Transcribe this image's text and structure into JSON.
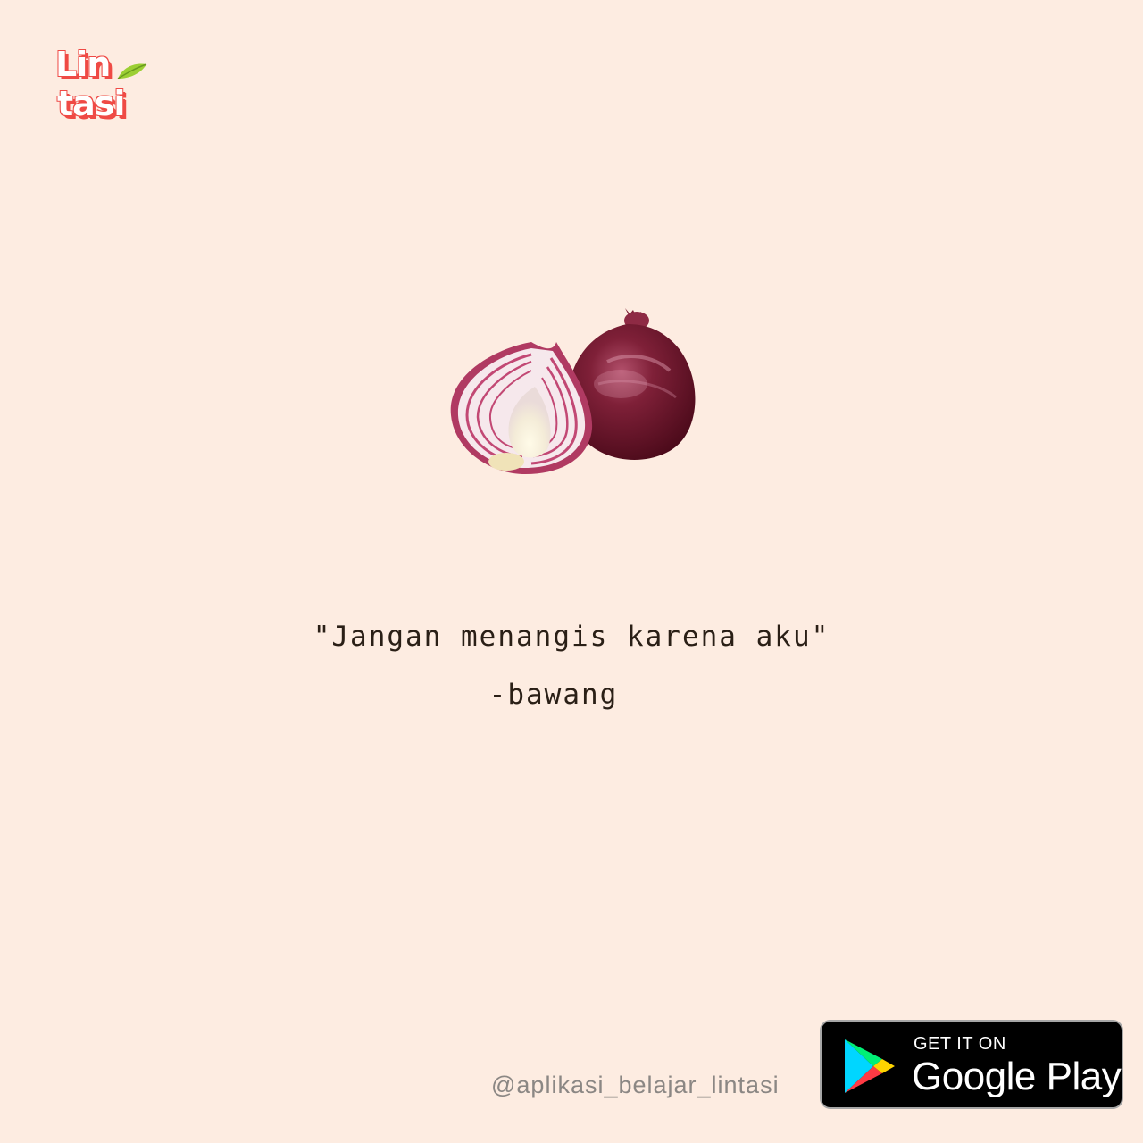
{
  "logo": {
    "line1": "Lin",
    "line2": "tasi",
    "accent_color": "#ef4a45",
    "leaf_color": "#9ccf34"
  },
  "illustration": {
    "icon": "onion-icon",
    "colors": {
      "skin": "#6e1628",
      "flesh": "#f4e6e8",
      "ring": "#c24874"
    }
  },
  "quote": {
    "text": "\"Jangan menangis karena aku\"",
    "author": "-bawang"
  },
  "footer": {
    "handle": "@aplikasi_belajar_lintasi",
    "badge": {
      "small_text": "GET IT ON",
      "big_text": "Google Play",
      "icon": "google-play-icon"
    }
  },
  "colors": {
    "background": "#fdece1",
    "text": "#2a1f16",
    "handle": "#8b8784"
  }
}
